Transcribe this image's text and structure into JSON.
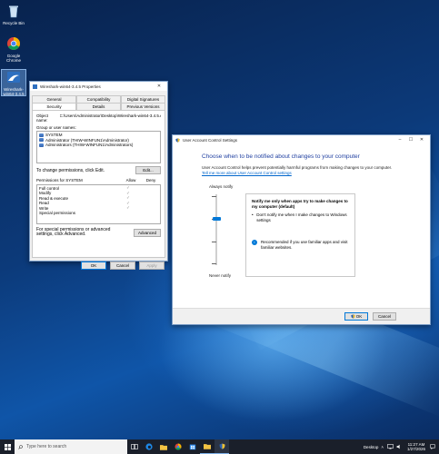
{
  "desktop": {
    "icons": [
      {
        "label": "Recycle Bin"
      },
      {
        "label": "Google Chrome"
      },
      {
        "label": "Wireshark-win64-3.4.5"
      }
    ]
  },
  "props_dialog": {
    "title": "Wireshark-win64-3.4.5 Properties",
    "tabs_row1": [
      "General",
      "Compatibility",
      "Digital Signatures"
    ],
    "tabs_row2": [
      "Security",
      "Details",
      "Previous Versions"
    ],
    "object_name_label": "Object name:",
    "object_name_value": "C:\\Users\\Administrator\\Desktop\\Wireshark-win64-3.4.5.exe",
    "group_label": "Group or user names:",
    "groups": [
      "SYSTEM",
      "Administrator (THIW-WINFUN1\\Administrator)",
      "Administrators (THIW-WINFUN1\\Administrators)"
    ],
    "change_perm_text": "To change permissions, click Edit.",
    "edit_button": "Edit...",
    "permissions_for": "Permissions for SYSTEM",
    "allow_header": "Allow",
    "deny_header": "Deny",
    "permissions": [
      {
        "name": "Full control",
        "allow": "✓",
        "deny": ""
      },
      {
        "name": "Modify",
        "allow": "✓",
        "deny": ""
      },
      {
        "name": "Read & execute",
        "allow": "✓",
        "deny": ""
      },
      {
        "name": "Read",
        "allow": "✓",
        "deny": ""
      },
      {
        "name": "Write",
        "allow": "✓",
        "deny": ""
      },
      {
        "name": "Special permissions",
        "allow": "",
        "deny": ""
      }
    ],
    "special_text": "For special permissions or advanced settings, click Advanced.",
    "advanced_button": "Advanced",
    "ok_button": "OK",
    "cancel_button": "Cancel",
    "apply_button": "Apply"
  },
  "uac_dialog": {
    "title": "User Account Control Settings",
    "heading": "Choose when to be notified about changes to your computer",
    "description": "User Account Control helps prevent potentially harmful programs from making changes to your computer.",
    "link": "Tell me more about User Account Control settings",
    "always_notify": "Always notify",
    "never_notify": "Never notify",
    "info_title": "Notify me only when apps try to make changes to my computer (default)",
    "info_bullet": "Don't notify me when I make changes to Windows settings",
    "info_recommended": "Recommended if you use familiar apps and visit familiar websites.",
    "ok_button": "OK",
    "cancel_button": "Cancel"
  },
  "taskbar": {
    "search_placeholder": "Type here to search",
    "desktop_label": "Desktop",
    "time": "11:27 AM",
    "date": "1/27/2026"
  }
}
